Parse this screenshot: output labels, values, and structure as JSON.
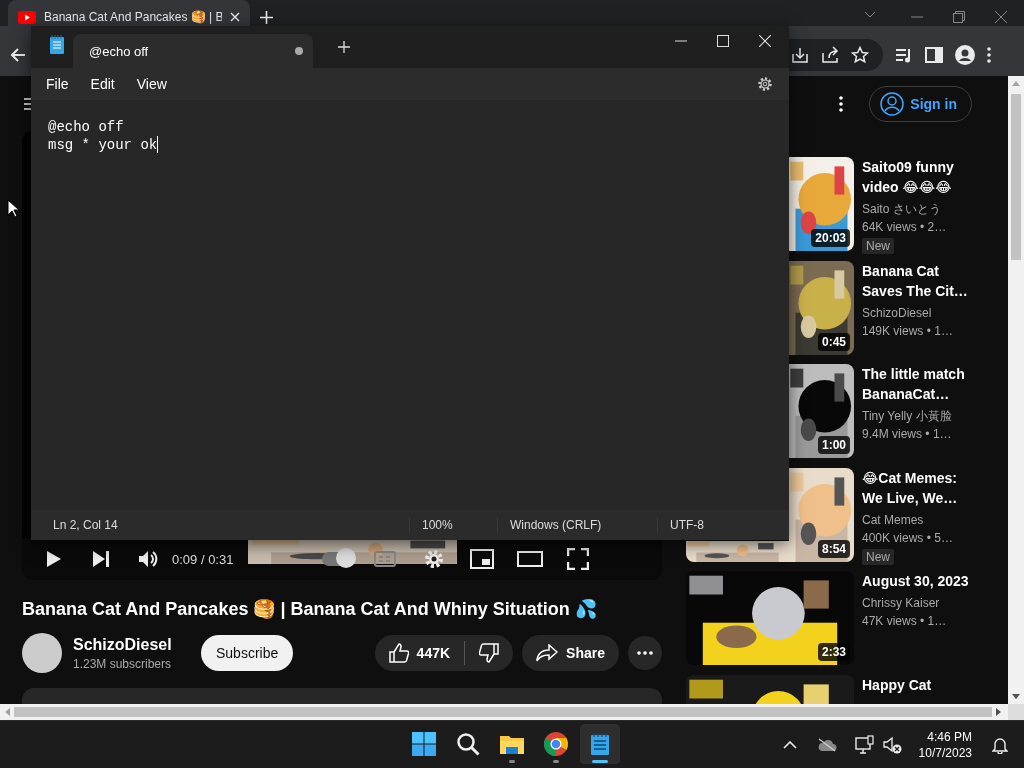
{
  "browser": {
    "tab": {
      "title": "Banana Cat And Pancakes 🥞 | B",
      "selected": true
    }
  },
  "youtube": {
    "sign_in": "Sign in",
    "player": {
      "time": "0:09 / 0:31",
      "autoplay": true
    },
    "video": {
      "title": "Banana Cat And Pancakes 🥞 | Banana Cat And Whiny Situation 💦",
      "channel": "SchizoDiesel",
      "subscribers": "1.23M subscribers",
      "subscribe": "Subscribe",
      "likes": "447K",
      "share": "Share"
    },
    "recommendations": [
      {
        "title": "Saito09 funny video 😂😂😂",
        "channel": "Saito さいとう",
        "meta": "64K views  • 2…",
        "duration": "20:03",
        "badge": "New"
      },
      {
        "title": "Banana Cat Saves The Cit…",
        "channel": "SchizoDiesel",
        "meta": "149K views  • 1…",
        "duration": "0:45"
      },
      {
        "title": "The little match BananaCat…",
        "channel": "Tiny Yelly 小黃脸",
        "meta": "9.4M views  • 1…",
        "duration": "1:00"
      },
      {
        "title": "😂Cat Memes: We Live, We…",
        "channel": "Cat Memes",
        "meta": "400K views  • 5…",
        "duration": "8:54",
        "badge": "New"
      },
      {
        "title": "August 30, 2023",
        "channel": "Chrissy Kaiser",
        "meta": "47K views  • 1…",
        "duration": "2:33"
      },
      {
        "title": "Happy Cat"
      }
    ]
  },
  "notepad": {
    "tab": {
      "title": "@echo off",
      "unsaved": true
    },
    "menu": [
      "File",
      "Edit",
      "View"
    ],
    "lines": [
      "@echo off",
      "msg * your ok"
    ],
    "status_bar": [
      "Ln 2, Col 14",
      "100%",
      "Windows (CRLF)",
      "UTF-8"
    ]
  },
  "taskbar": {
    "apps": [
      {
        "kind": "start",
        "selected": false,
        "running": false
      },
      {
        "kind": "search",
        "selected": false,
        "running": false
      },
      {
        "kind": "explorer",
        "selected": false,
        "running": true
      },
      {
        "kind": "chrome",
        "selected": false,
        "running": true
      },
      {
        "kind": "notepad",
        "selected": true,
        "running": true
      }
    ],
    "time": "4:46 PM",
    "date": "10/7/2023"
  }
}
